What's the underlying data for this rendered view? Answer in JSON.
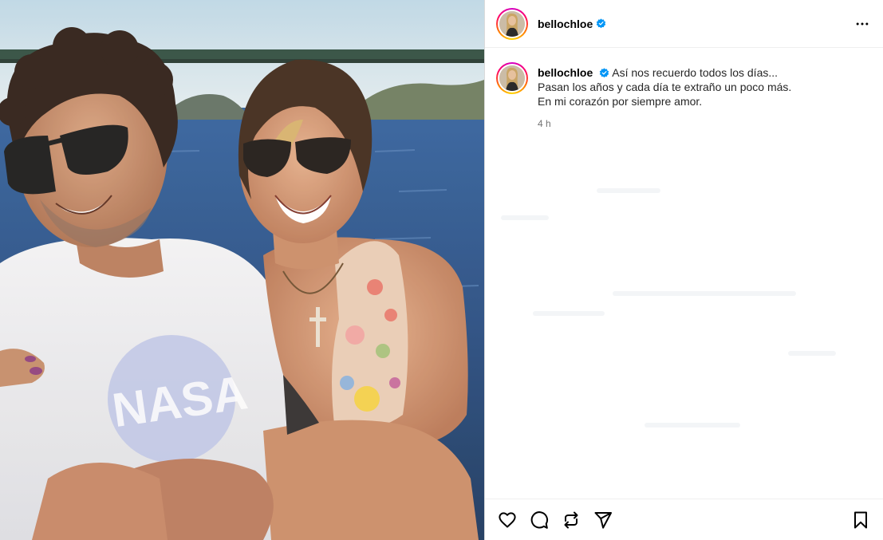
{
  "post": {
    "username": "bellochloe",
    "verified": true,
    "more_icon": "more-horizontal-icon",
    "image_alt": "Foto de una pareja sonriendo con gafas de sol en un barco frente al mar"
  },
  "caption": {
    "username": "bellochloe",
    "lines": [
      "Así nos recuerdo todos los días...",
      "Pasan los años y cada día te extraño un poco más.",
      "En mi corazón por siempre amor."
    ],
    "time": "4 h"
  },
  "actions": {
    "like_icon": "heart-icon",
    "comment_icon": "comment-icon",
    "repost_icon": "repost-icon",
    "share_icon": "send-icon",
    "save_icon": "bookmark-icon"
  },
  "colors": {
    "verified_blue": "#0095f6",
    "divider": "#dbdbdb",
    "secondary_text": "#737373"
  }
}
